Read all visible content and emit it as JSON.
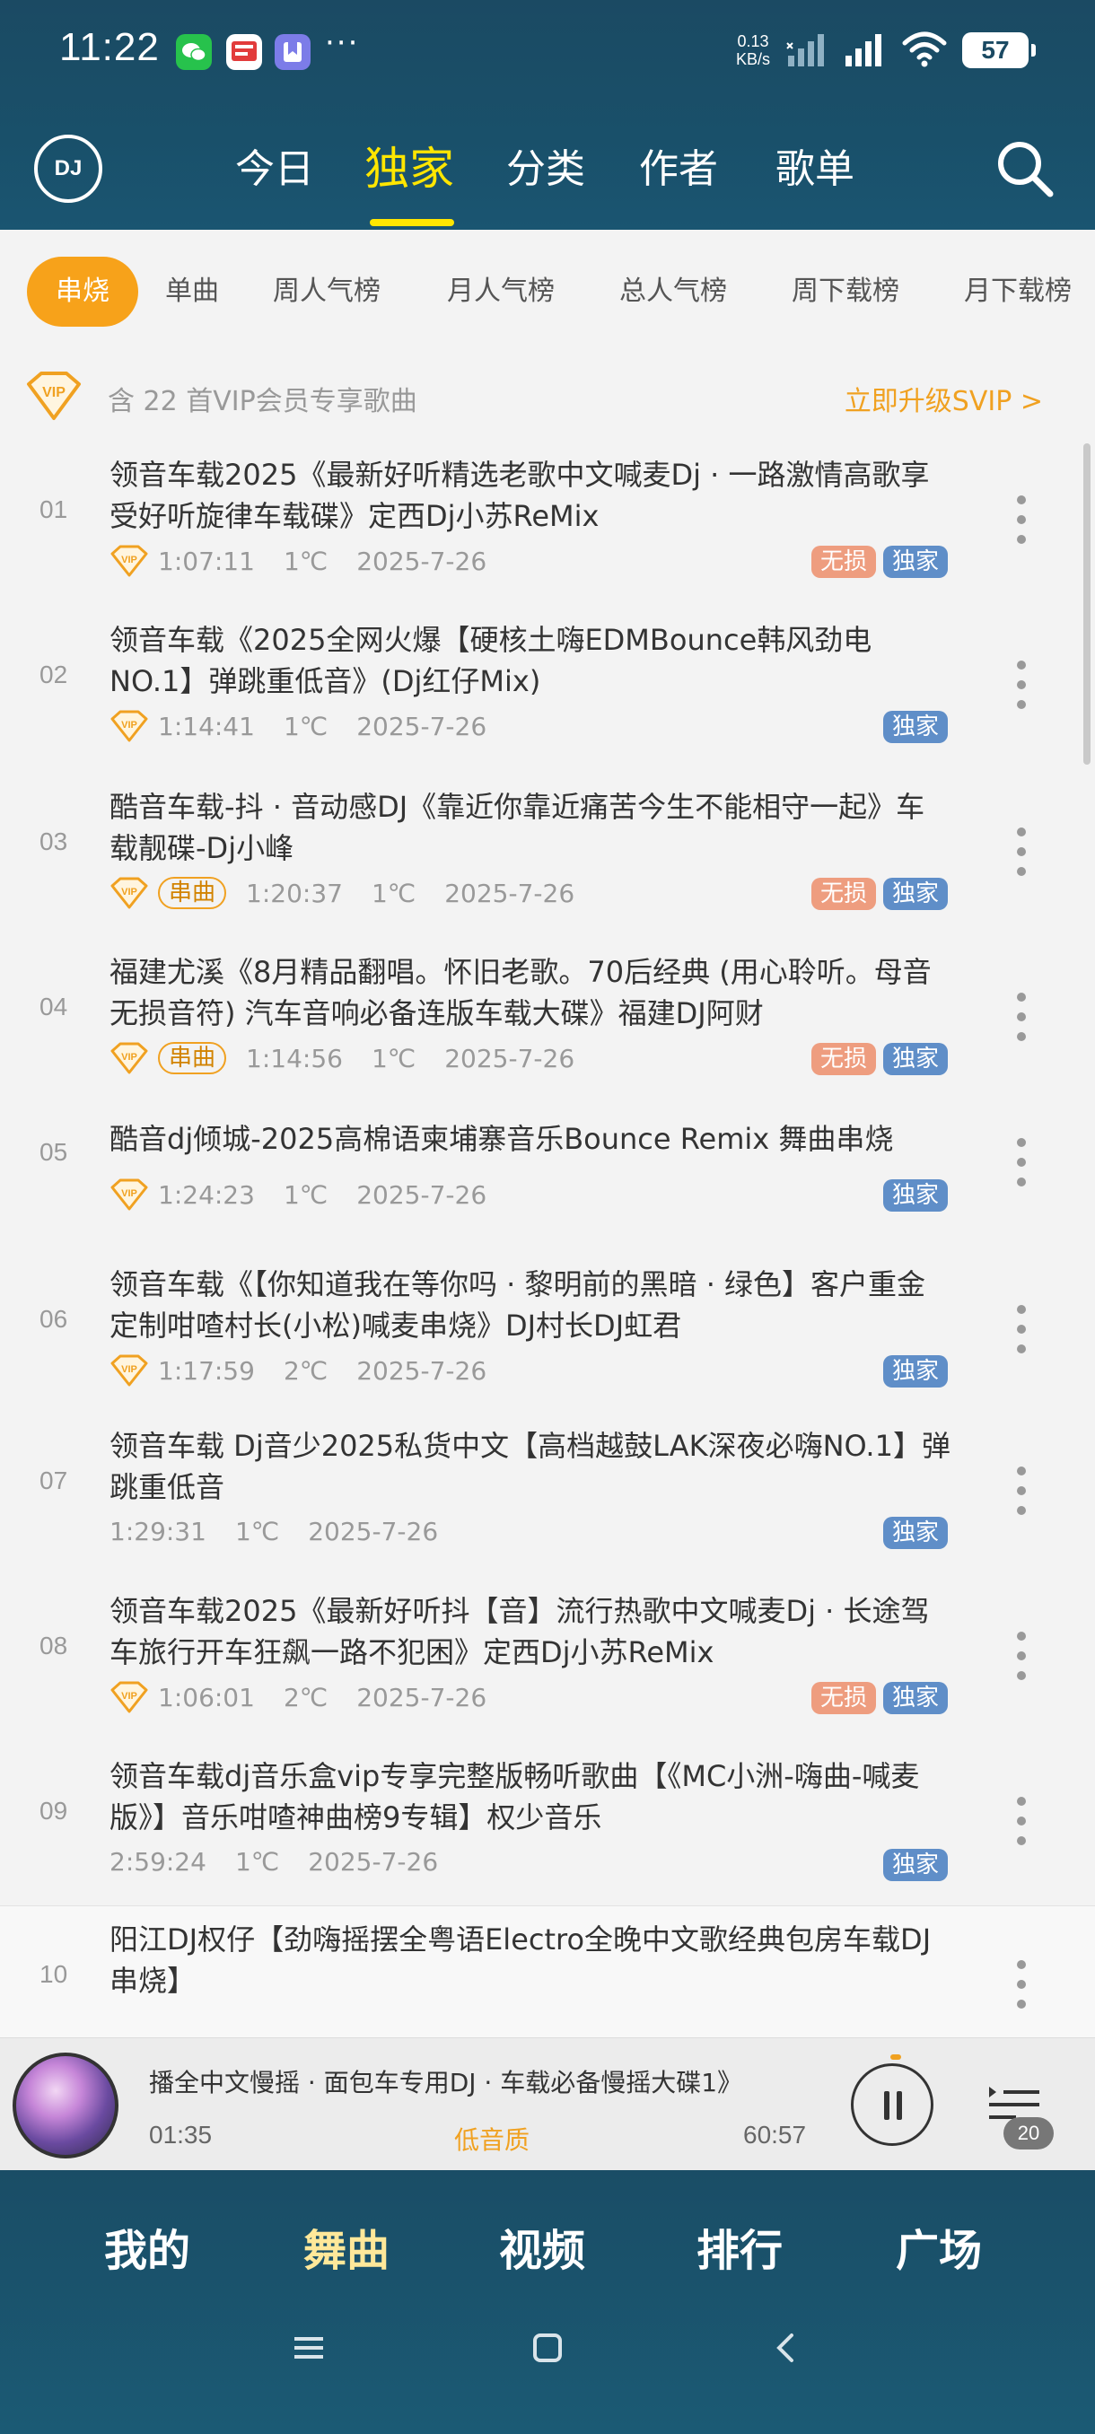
{
  "status": {
    "time": "11:22",
    "more": "···",
    "net_speed_value": "0.13",
    "net_speed_unit": "KB/s",
    "battery": "57"
  },
  "header": {
    "logo_text": "DJ",
    "tabs": [
      {
        "label": "今日"
      },
      {
        "label": "独家"
      },
      {
        "label": "分类"
      },
      {
        "label": "作者"
      },
      {
        "label": "歌单"
      }
    ]
  },
  "chips": [
    {
      "label": "串烧"
    },
    {
      "label": "单曲"
    },
    {
      "label": "周人气榜"
    },
    {
      "label": "月人气榜"
    },
    {
      "label": "总人气榜"
    },
    {
      "label": "周下载榜"
    },
    {
      "label": "月下载榜"
    }
  ],
  "vip_bar": {
    "text": "含 22 首VIP会员专享歌曲",
    "cta": "立即升级SVIP >"
  },
  "songs": [
    {
      "num": "01",
      "title": "领音车载2025《最新好听精选老歌中文喊麦Dj · 一路激情高歌享受好听旋律车载碟》定西Dj小苏ReMix",
      "duration": "1:07:11",
      "temp": "1℃",
      "date": "2025-7-26",
      "lossless": "无损",
      "exclusive": "独家"
    },
    {
      "num": "02",
      "title": "领音车载《2025全网火爆【硬核土嗨EDMBounce韩风劲电NO.1】弹跳重低音》(Dj红仔Mix)",
      "duration": "1:14:41",
      "temp": "1℃",
      "date": "2025-7-26",
      "exclusive": "独家"
    },
    {
      "num": "03",
      "title": "酷音车载-抖 · 音动感DJ《靠近你靠近痛苦今生不能相守一起》车载靓碟-Dj小峰",
      "serial": "串曲",
      "duration": "1:20:37",
      "temp": "1℃",
      "date": "2025-7-26",
      "lossless": "无损",
      "exclusive": "独家"
    },
    {
      "num": "04",
      "title": "福建尤溪《8月精品翻唱。怀旧老歌。70后经典 (用心聆听。母音无损音符) 汽车音响必备连版车载大碟》福建DJ阿财",
      "serial": "串曲",
      "duration": "1:14:56",
      "temp": "1℃",
      "date": "2025-7-26",
      "lossless": "无损",
      "exclusive": "独家"
    },
    {
      "num": "05",
      "title": "酷音dj倾城-2025高棉语柬埔寨音乐Bounce Remix 舞曲串烧",
      "duration": "1:24:23",
      "temp": "1℃",
      "date": "2025-7-26",
      "exclusive": "独家"
    },
    {
      "num": "06",
      "title": "领音车载《【你知道我在等你吗 · 黎明前的黑暗 · 绿色】客户重金定制咁喳村长(小松)喊麦串烧》DJ村长DJ虹君",
      "duration": "1:17:59",
      "temp": "2℃",
      "date": "2025-7-26",
      "exclusive": "独家"
    },
    {
      "num": "07",
      "title": "领音车载 Dj音少2025私货中文【高档越鼓LAK深夜必嗨NO.1】弹跳重低音",
      "duration": "1:29:31",
      "temp": "1℃",
      "date": "2025-7-26",
      "exclusive": "独家"
    },
    {
      "num": "08",
      "title": "领音车载2025《最新好听抖【音】流行热歌中文喊麦Dj · 长途驾车旅行开车狂飙一路不犯困》定西Dj小苏ReMix",
      "duration": "1:06:01",
      "temp": "2℃",
      "date": "2025-7-26",
      "lossless": "无损",
      "exclusive": "独家"
    },
    {
      "num": "09",
      "title": "领音车载dj音乐盒vip专享完整版畅听歌曲【《MC小洲-嗨曲-喊麦版》】音乐咁喳神曲榜9专辑】权少音乐",
      "duration": "2:59:24",
      "temp": "1℃",
      "date": "2025-7-26",
      "exclusive": "独家"
    },
    {
      "num": "10",
      "title": "阳江DJ权仔【劲嗨摇摆全粤语Electro全晚中文歌经典包房车载DJ串烧】"
    }
  ],
  "player": {
    "title": "播全中文慢摇 · 面包车专用DJ · 车载必备慢摇大碟1》",
    "current_time": "01:35",
    "quality": "低音质",
    "total_time": "60:57",
    "queue_count": "20"
  },
  "bottom_nav": [
    {
      "label": "我的"
    },
    {
      "label": "舞曲"
    },
    {
      "label": "视频"
    },
    {
      "label": "排行"
    },
    {
      "label": "广场"
    }
  ],
  "colors": {
    "header_bg": "#1b4a63",
    "accent_yellow": "#ffe600",
    "accent_orange": "#f7a21a",
    "tag_lossless": "#ee9d7f",
    "tag_exclusive": "#5f8ec8"
  }
}
